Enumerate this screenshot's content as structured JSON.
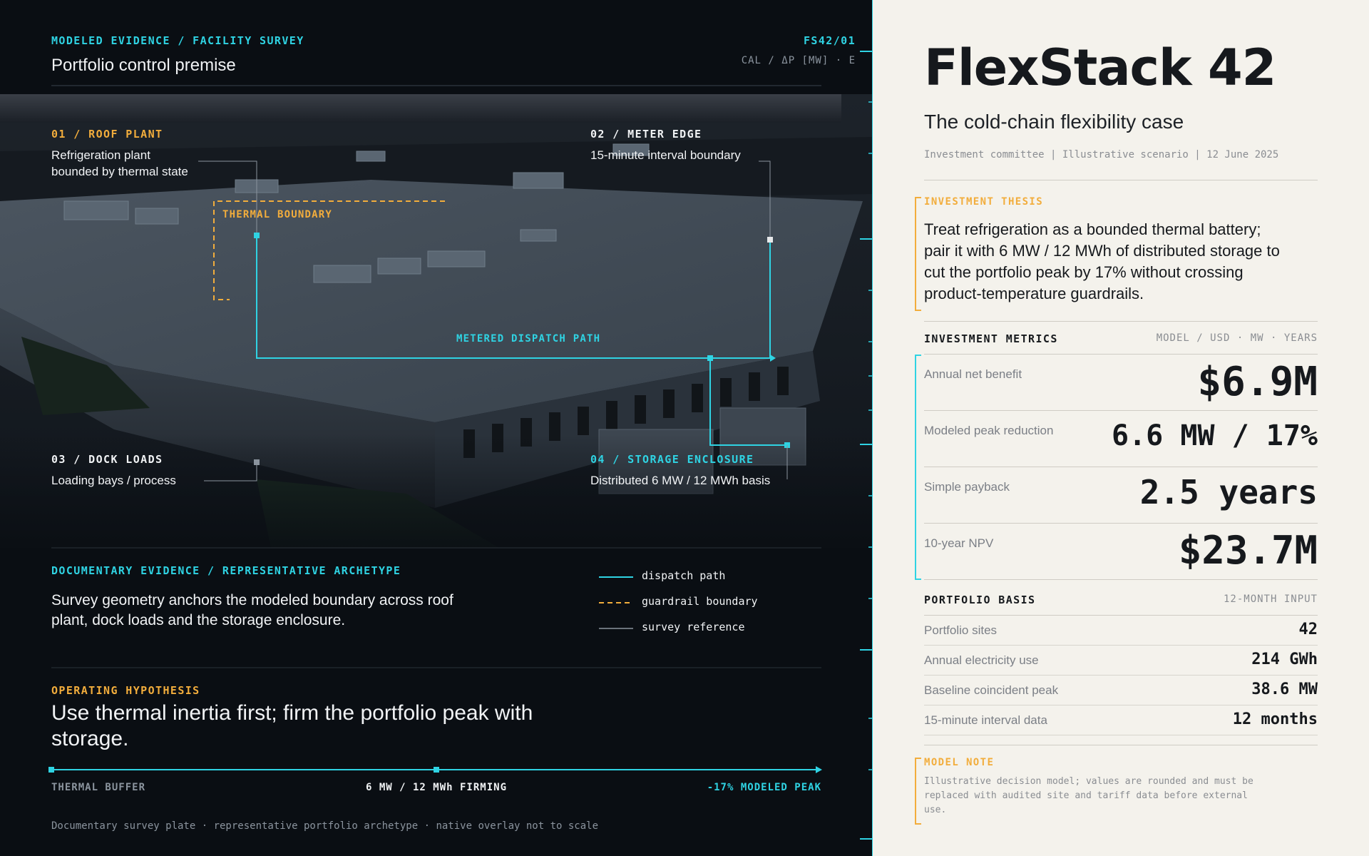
{
  "left": {
    "header": {
      "eyebrow": "MODELED EVIDENCE / FACILITY SURVEY",
      "title": "Portfolio control premise",
      "code": "FS42/01",
      "calibration": "CAL / ΔP [MW] · E"
    },
    "callouts": {
      "roof": {
        "tag": "01 / ROOF PLANT",
        "text_line1": "Refrigeration plant",
        "text_line2": "bounded by thermal state"
      },
      "meter": {
        "tag": "02 / METER EDGE",
        "text": "15-minute interval boundary"
      },
      "dock": {
        "tag": "03 / DOCK LOADS",
        "text": "Loading bays / process"
      },
      "storage": {
        "tag": "04 / STORAGE ENCLOSURE",
        "text": "Distributed 6 MW / 12 MWh basis"
      },
      "thermal_boundary": "THERMAL BOUNDARY",
      "dispatch_path": "METERED DISPATCH PATH"
    },
    "documentary": {
      "eyebrow": "DOCUMENTARY EVIDENCE / REPRESENTATIVE ARCHETYPE",
      "text_line1": "Survey geometry anchors the modeled boundary across roof",
      "text_line2": "plant, dock loads and the storage enclosure."
    },
    "legend": [
      {
        "label": "dispatch path",
        "color": "#2fd3e3",
        "style": "solid"
      },
      {
        "label": "guardrail boundary",
        "color": "#f2ad3c",
        "style": "dashed"
      },
      {
        "label": "survey reference",
        "color": "#8b949e",
        "style": "solid"
      }
    ],
    "hypothesis": {
      "eyebrow": "OPERATING HYPOTHESIS",
      "text_line1": "Use thermal inertia first; firm the portfolio peak with",
      "text_line2": "storage."
    },
    "timeline": {
      "start": "THERMAL BUFFER",
      "middle": "6 MW / 12 MWh FIRMING",
      "end": "-17% MODELED PEAK"
    },
    "footnote": "Documentary survey plate · representative portfolio archetype · native overlay not to scale"
  },
  "right": {
    "title": "FlexStack 42",
    "subtitle": "The cold-chain flexibility case",
    "meta": "Investment committee | Illustrative scenario | 12 June 2025",
    "thesis": {
      "eyebrow": "INVESTMENT THESIS",
      "line1": "Treat refrigeration as a bounded thermal battery;",
      "line2": "pair it with 6 MW / 12 MWh of distributed storage to",
      "line3": "cut the portfolio peak by 17% without crossing",
      "line4": "product-temperature guardrails."
    },
    "metrics": {
      "heading": "INVESTMENT METRICS",
      "units": "MODEL / USD · MW · YEARS",
      "rows": [
        {
          "label": "Annual net benefit",
          "value": "$6.9M"
        },
        {
          "label": "Modeled peak reduction",
          "value": "6.6 MW / 17%"
        },
        {
          "label": "Simple payback",
          "value": "2.5 years"
        },
        {
          "label": "10-year NPV",
          "value": "$23.7M"
        }
      ]
    },
    "basis": {
      "heading": "PORTFOLIO BASIS",
      "units": "12-MONTH INPUT",
      "rows": [
        {
          "label": "Portfolio sites",
          "value": "42"
        },
        {
          "label": "Annual electricity use",
          "value": "214 GWh"
        },
        {
          "label": "Baseline coincident peak",
          "value": "38.6 MW"
        },
        {
          "label": "15-minute interval data",
          "value": "12 months"
        }
      ]
    },
    "note": {
      "eyebrow": "MODEL NOTE",
      "line1": "Illustrative decision model; values are rounded and must be",
      "line2": "replaced with audited site and tariff data before external",
      "line3": "use."
    }
  },
  "colors": {
    "accent": "#2fd3e3",
    "guardrail": "#f2ad3c",
    "panel": "#f4f2ec",
    "dark": "#0a0e13"
  }
}
